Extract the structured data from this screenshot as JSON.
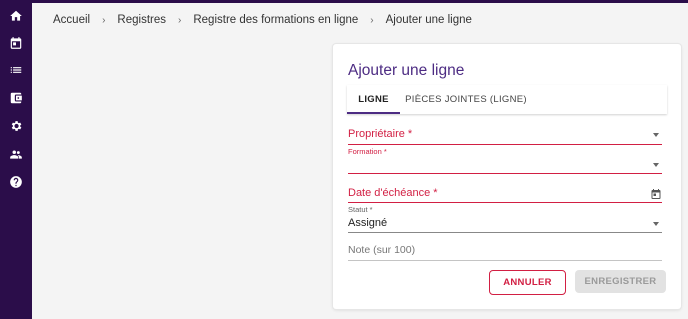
{
  "sidebar": {
    "items": [
      {
        "icon": "home-icon"
      },
      {
        "icon": "calendar-icon"
      },
      {
        "icon": "list-icon"
      },
      {
        "icon": "wallet-icon"
      },
      {
        "icon": "gear-icon"
      },
      {
        "icon": "people-icon"
      },
      {
        "icon": "help-icon"
      }
    ],
    "background": "#2b0d4a"
  },
  "breadcrumb": {
    "items": [
      "Accueil",
      "Registres",
      "Registre des formations en ligne",
      "Ajouter une ligne"
    ],
    "separator": "›"
  },
  "form": {
    "title": "Ajouter une ligne",
    "tabs": [
      {
        "label": "LIGNE",
        "active": true
      },
      {
        "label": "PIÈCES JOINTES (LIGNE)",
        "active": false
      }
    ],
    "fields": {
      "owner": {
        "label": "Propriétaire *",
        "value": ""
      },
      "training": {
        "label": "Formation *",
        "value": ""
      },
      "due_date": {
        "label": "Date d'échéance *",
        "value": ""
      },
      "status": {
        "label": "Statut *",
        "value": "Assigné"
      },
      "score": {
        "placeholder": "Note (sur 100)",
        "value": ""
      }
    },
    "buttons": {
      "cancel": "ANNULER",
      "save": "ENREGISTRER"
    }
  },
  "colors": {
    "accent": "#4d2c83",
    "error": "#d21f43",
    "disabled_bg": "#e2e2e2"
  }
}
